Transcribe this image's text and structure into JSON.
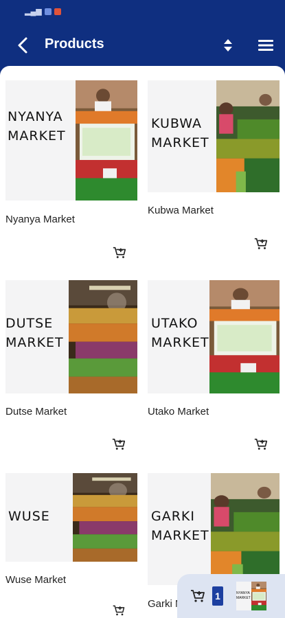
{
  "status_bar": {
    "left_icons": "sim-wifi-notification-icons",
    "time": ""
  },
  "header": {
    "title": "Products",
    "back_icon": "back-arrow-icon",
    "sort_icon": "sort-icon",
    "menu_icon": "menu-icon"
  },
  "products": [
    {
      "name": "Nyanya Market",
      "thumb_line1": "NYANYA",
      "thumb_line2": "MARKET",
      "photo": "produce-stall"
    },
    {
      "name": "Kubwa Market",
      "thumb_line1": "KUBWA",
      "thumb_line2": "MARKET",
      "photo": "vegetable-stall"
    },
    {
      "name": "Dutse Market",
      "thumb_line1": "DUTSE",
      "thumb_line2": "MARKET",
      "photo": "fruit-aisle"
    },
    {
      "name": "Utako Market",
      "thumb_line1": "UTAKO",
      "thumb_line2": "MARKET",
      "photo": "produce-stall"
    },
    {
      "name": "Wuse Market",
      "thumb_line1": "WUSE",
      "thumb_line2": "",
      "photo": "fruit-aisle"
    },
    {
      "name": "Garki Market",
      "thumb_line1": "GARKI",
      "thumb_line2": "MARKET",
      "photo": "vegetable-stall"
    }
  ],
  "cart": {
    "count": "1",
    "icon": "cart-icon",
    "thumb_line1": "NYANYA",
    "thumb_line2": "MARKET"
  },
  "colors": {
    "appbar": "#0f2f80",
    "accent": "#1c3fa0",
    "cart_bg": "#dde4f2"
  }
}
